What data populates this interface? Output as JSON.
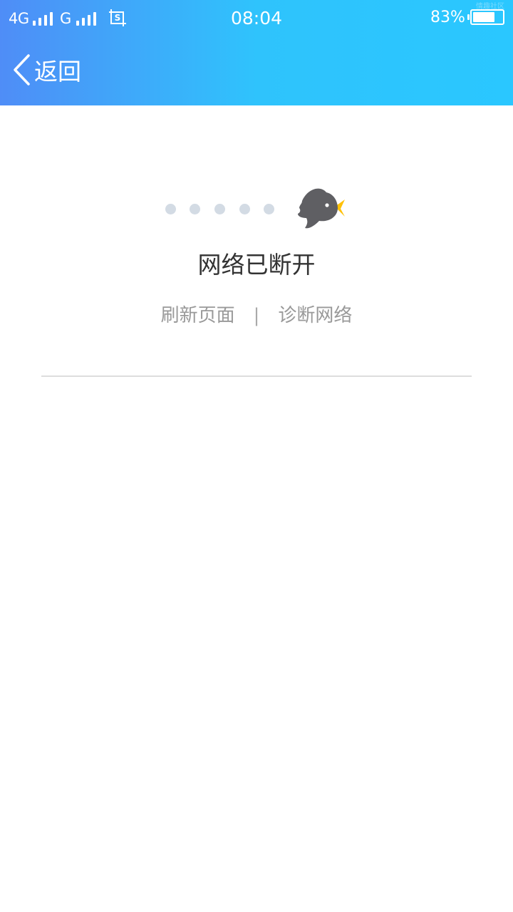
{
  "status_bar": {
    "network1": "4G",
    "network2": "G",
    "screenshot_icon": "screenshot-icon",
    "time": "08:04",
    "battery_percent": "83%",
    "battery_level": 0.83,
    "watermark": "情趣社区"
  },
  "header": {
    "back_icon": "chevron-left-icon",
    "back_label": "返回"
  },
  "colors": {
    "header_gradient_start": "#4f8df7",
    "header_gradient_end": "#2ac7ff",
    "dot": "#d3dbe4",
    "bird": "#5f5f63",
    "beak": "#ffc107"
  },
  "main": {
    "illustration": "bird-icon",
    "title": "网络已断开",
    "refresh_label": "刷新页面",
    "separator": "|",
    "diagnose_label": "诊断网络"
  }
}
